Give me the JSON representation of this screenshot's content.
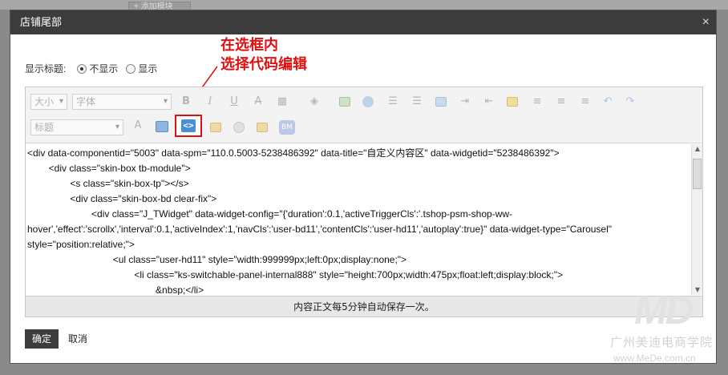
{
  "background": {
    "tab_label": "+ 添加模块"
  },
  "dialog": {
    "title": "店铺尾部",
    "close_label": "×"
  },
  "title_setting": {
    "label": "显示标题:",
    "options": [
      {
        "label": "不显示",
        "selected": true
      },
      {
        "label": "显示",
        "selected": false
      }
    ]
  },
  "annotation": {
    "line1": "在选框内",
    "line2": "选择代码编辑",
    "color": "#e01010"
  },
  "toolbar": {
    "font_size_placeholder": "大小",
    "font_family_placeholder": "字体",
    "heading_placeholder": "标题",
    "icons_row1": [
      "bold-icon",
      "italic-icon",
      "underline-icon",
      "strikethrough-icon",
      "table-icon",
      "fill-color-icon",
      "image-icon",
      "emoji-icon",
      "bullet-list-icon",
      "numbered-list-icon",
      "align-block-icon",
      "indent-icon",
      "outdent-icon",
      "link-icon",
      "align-left-icon",
      "align-center-icon",
      "align-right-icon",
      "undo-icon",
      "redo-icon"
    ],
    "icons_row2": [
      "text-color-icon",
      "preview-icon",
      "code-view-icon",
      "insert-image-icon",
      "eraser-icon",
      "hr-icon",
      "bm-icon"
    ],
    "bold_glyph": "B",
    "italic_glyph": "I",
    "underline_glyph": "U",
    "strike_glyph": "A",
    "code_glyph": "<>",
    "bm_glyph": "BM"
  },
  "code": {
    "lines": [
      "<div data-componentid=\"5003\" data-spm=\"110.0.5003-5238486392\" data-title=\"自定义内容区\" data-widgetid=\"5238486392\">",
      "        <div class=\"skin-box tb-module\">",
      "                <s class=\"skin-box-tp\"></s>",
      "                <div class=\"skin-box-bd clear-fix\">",
      "                        <div class=\"J_TWidget\" data-widget-config=\"{'duration':0.1,'activeTriggerCls':'.tshop-psm-shop-ww-",
      "hover','effect':'scrollx','interval':0.1,'activeIndex':1,'navCls':'user-bd11','contentCls':'user-hd11','autoplay':true}\" data-widget-type=\"Carousel\"",
      "style=\"position:relative;\">",
      "                                <ul class=\"user-hd11\" style=\"width:999999px;left:0px;display:none;\">",
      "                                        <li class=\"ks-switchable-panel-internal888\" style=\"height:700px;width:475px;float:left;display:block;\">",
      "                                                &nbsp;</li>"
    ]
  },
  "status": "内容正文每5分钟自动保存一次。",
  "buttons": {
    "ok": "确定",
    "cancel": "取消"
  },
  "watermark": {
    "logo": "MD",
    "name": "广州美迪电商学院",
    "url": "www.MeDe.com.cn"
  }
}
